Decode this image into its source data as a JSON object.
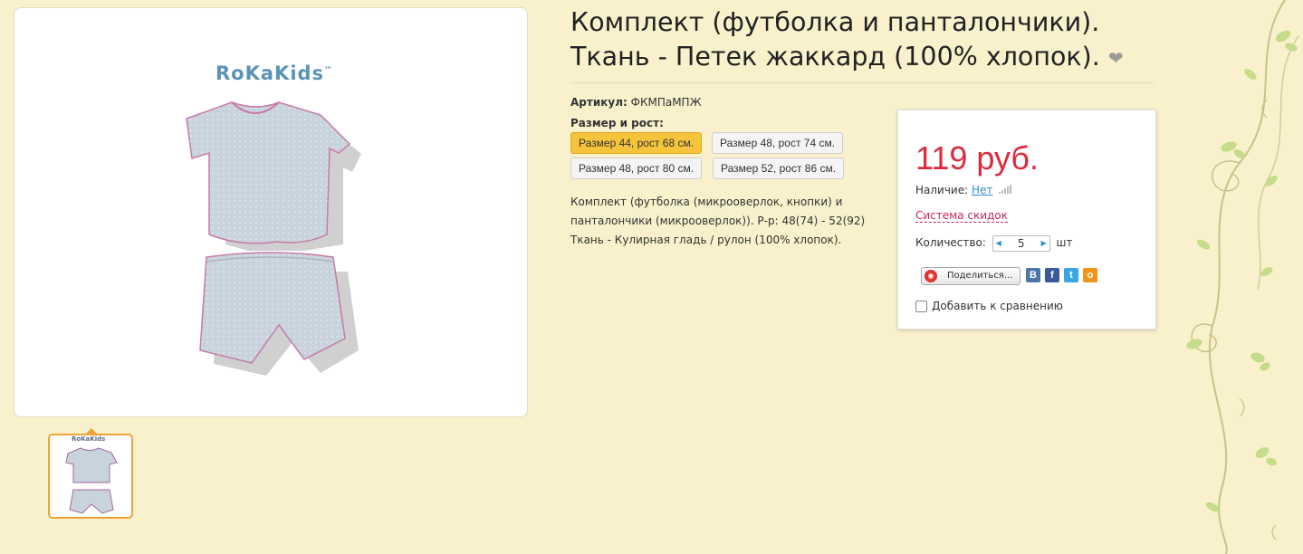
{
  "product": {
    "title": "Комплект (футболка и панталончики). Ткань - Петек жаккард (100% хлопок).",
    "brand": "RoKaKids",
    "brand_tm": "™",
    "sku_label": "Артикул:",
    "sku_value": "ФКМПаМПЖ",
    "size_label": "Размер и рост:",
    "sizes": [
      {
        "label": "Размер 44, рост 68 см.",
        "selected": true
      },
      {
        "label": "Размер 48, рост 74 см.",
        "selected": false
      },
      {
        "label": "Размер 48, рост 80 см.",
        "selected": false
      },
      {
        "label": "Размер 52, рост 86 см.",
        "selected": false
      }
    ],
    "description_lines": [
      "Комплект (футболка (микрооверлок, кнопки) и",
      "панталончики (микрооверлок)). Р-р: 48(74) - 52(92)",
      "Ткань - Кулирная гладь / рулон (100% хлопок)."
    ]
  },
  "buybox": {
    "price": "119 руб.",
    "availability_label": "Наличие:",
    "availability_value": "Нет",
    "discount_link": "Система скидок",
    "quantity_label": "Количество:",
    "quantity_value": "5",
    "quantity_unit": "шт",
    "share_label": "Поделиться...",
    "compare_label": "Добавить к сравнению"
  },
  "icons": {
    "favorite": "heart-icon",
    "social": [
      "vk-icon",
      "facebook-icon",
      "twitter-icon",
      "odnoklassniki-icon"
    ]
  },
  "colors": {
    "page_bg": "#f8f1cb",
    "price": "#dd2a3b",
    "selected_size": "#f5c43a",
    "link": "#2f8fc9",
    "thumb_border": "#f0a236"
  }
}
